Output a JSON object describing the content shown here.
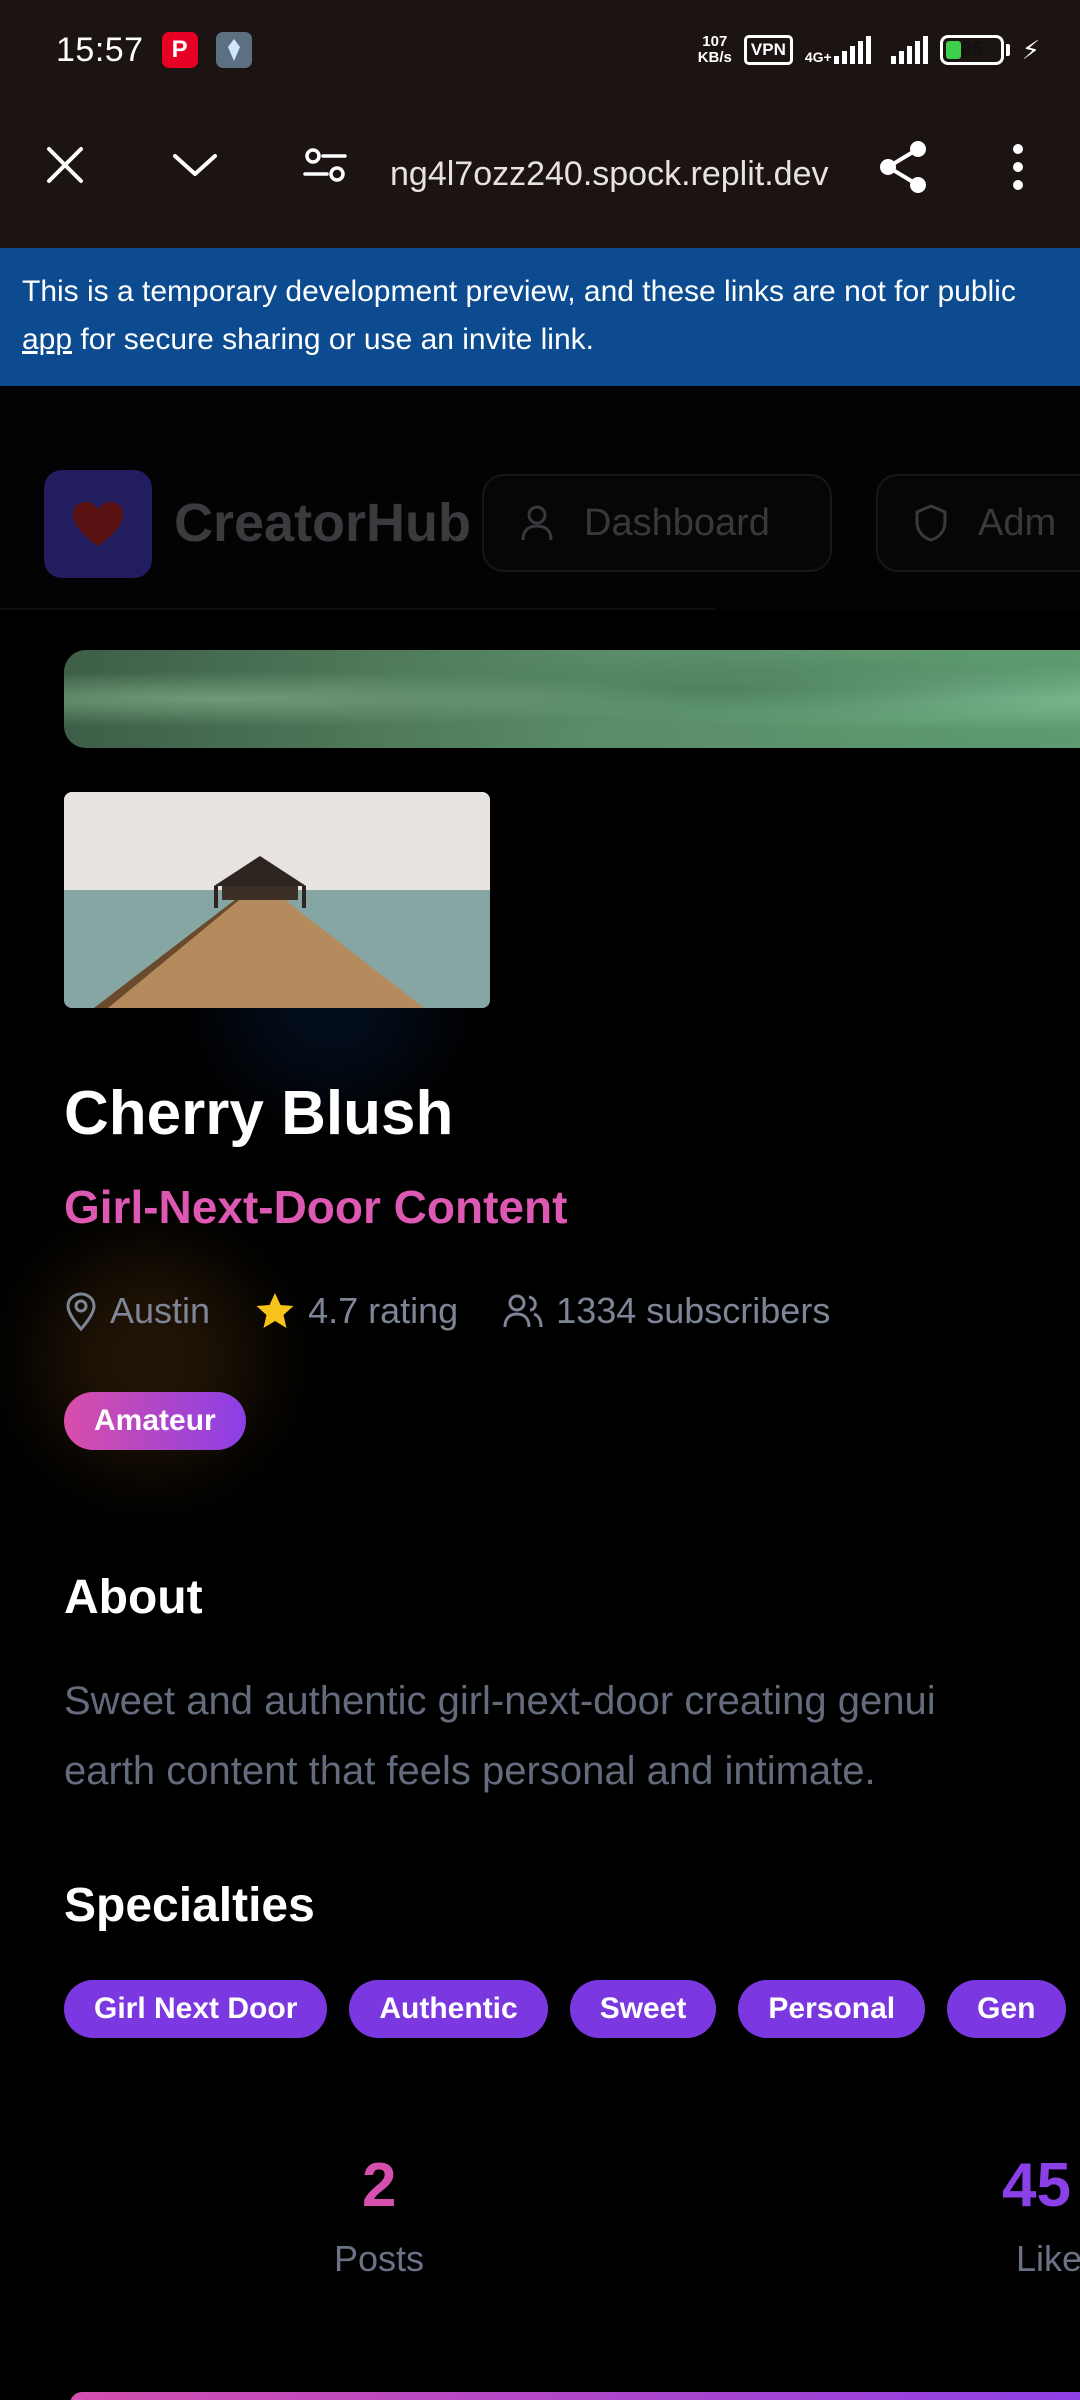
{
  "status_bar": {
    "time": "15:57",
    "net_speed_value": "107",
    "net_speed_unit": "KB/s",
    "vpn": "VPN",
    "network_type": "4G+",
    "battery": "26"
  },
  "browser": {
    "url": "ng4l7ozz240.spock.replit.dev"
  },
  "banner": {
    "line1": "This is a temporary development preview, and these links are not for public",
    "line2_link": "app",
    "line2_rest": " for secure sharing or use an invite link."
  },
  "header": {
    "logo_text": "CreatorHub",
    "nav": [
      {
        "label": "Dashboard"
      },
      {
        "label": "Adm"
      }
    ]
  },
  "profile": {
    "name": "Cherry Blush",
    "tagline": "Girl-Next-Door Content",
    "location": "Austin",
    "rating": "4.7 rating",
    "subscribers": "1334 subscribers",
    "category": "Amateur"
  },
  "about": {
    "title": "About",
    "line1": "Sweet and authentic girl-next-door creating genui",
    "line2": "earth content that feels personal and intimate."
  },
  "specialties": {
    "title": "Specialties",
    "items": [
      "Girl Next Door",
      "Authentic",
      "Sweet",
      "Personal",
      "Gen"
    ]
  },
  "stats": [
    {
      "value": "2",
      "label": "Posts"
    },
    {
      "value": "45",
      "label": "Like"
    }
  ],
  "colors": {
    "accent_pink": "#d54fae",
    "accent_purple": "#7c38e0",
    "banner_blue": "#0d4b91",
    "toolbar_bg": "#1c1313"
  }
}
